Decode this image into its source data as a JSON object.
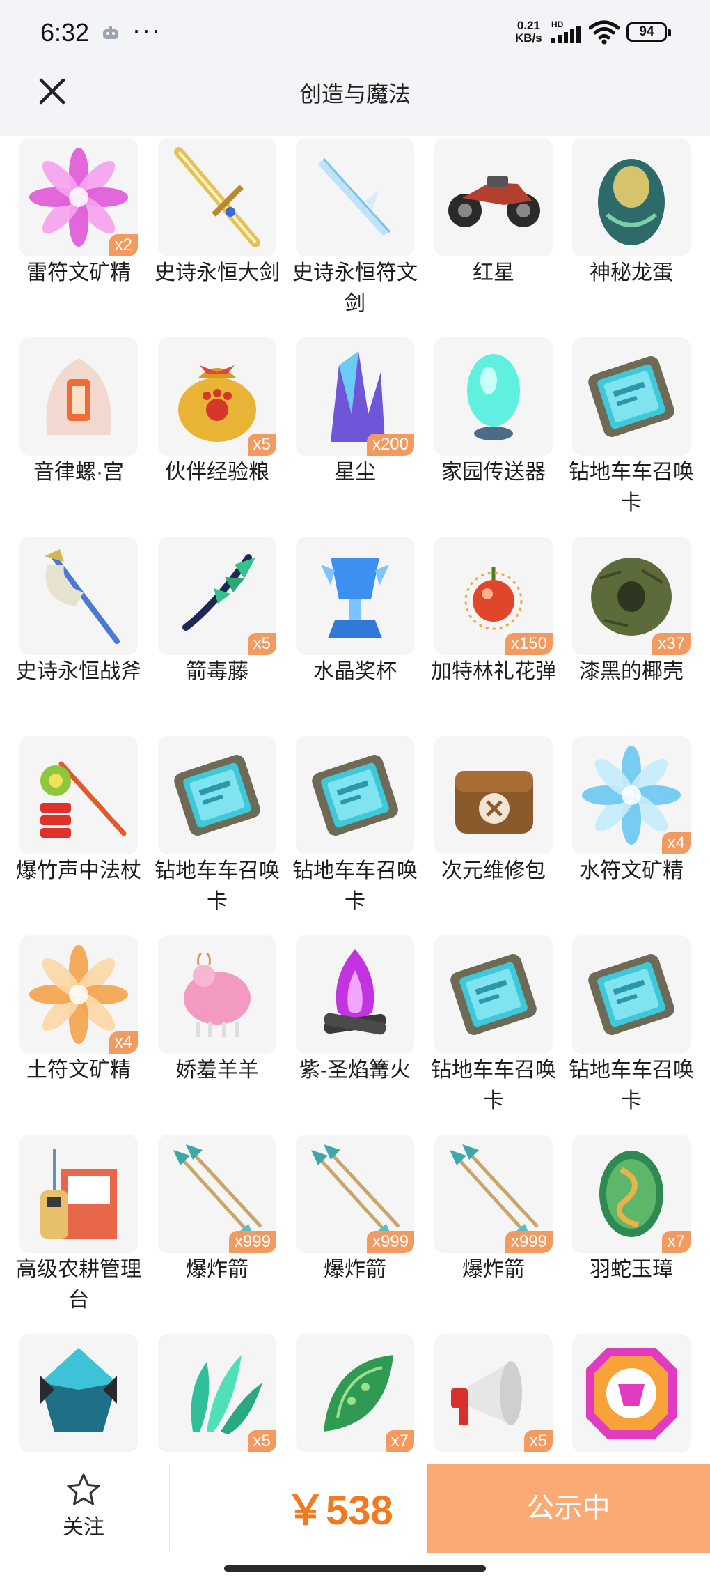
{
  "status_bar": {
    "time": "6:32",
    "more": "···",
    "net_speed_line1": "0.21",
    "net_speed_line2": "KB/s",
    "hd": "HD",
    "battery": "94"
  },
  "header": {
    "title": "创造与魔法"
  },
  "colors": {
    "accent": "#f39a60",
    "price": "#f2791f",
    "status_button": "#fcaa74"
  },
  "items": [
    {
      "name": "雷符文矿精",
      "badge": "x2",
      "icon": "pink-crystal-flower-icon"
    },
    {
      "name": "史诗永恒大剑",
      "badge": "",
      "icon": "golden-greatsword-icon"
    },
    {
      "name": "史诗永恒符文剑",
      "badge": "",
      "icon": "ice-rune-sword-icon"
    },
    {
      "name": "红星",
      "badge": "",
      "icon": "motorcycle-icon"
    },
    {
      "name": "神秘龙蛋",
      "badge": "",
      "icon": "dragon-egg-icon"
    },
    {
      "name": "音律螺·宫",
      "badge": "",
      "icon": "conch-shell-icon"
    },
    {
      "name": "伙伴经验粮",
      "badge": "x5",
      "icon": "paw-food-bag-icon"
    },
    {
      "name": "星尘",
      "badge": "x200",
      "icon": "stardust-crystal-icon"
    },
    {
      "name": "家园传送器",
      "badge": "",
      "icon": "teleporter-egg-icon"
    },
    {
      "name": "钻地车车召唤卡",
      "badge": "",
      "icon": "summon-card-icon"
    },
    {
      "name": "史诗永恒战斧",
      "badge": "",
      "icon": "battle-axe-icon"
    },
    {
      "name": "箭毒藤",
      "badge": "x5",
      "icon": "poison-vine-icon"
    },
    {
      "name": "水晶奖杯",
      "badge": "",
      "icon": "crystal-trophy-icon"
    },
    {
      "name": "加特林礼花弹",
      "badge": "x150",
      "icon": "firework-shell-icon"
    },
    {
      "name": "漆黑的椰壳",
      "badge": "x37",
      "icon": "coconut-shell-icon"
    },
    {
      "name": "爆竹声中法杖",
      "badge": "",
      "icon": "firecracker-staff-icon"
    },
    {
      "name": "钻地车车召唤卡",
      "badge": "",
      "icon": "summon-card-icon"
    },
    {
      "name": "钻地车车召唤卡",
      "badge": "",
      "icon": "summon-card-icon"
    },
    {
      "name": "次元维修包",
      "badge": "",
      "icon": "repair-bag-icon"
    },
    {
      "name": "水符文矿精",
      "badge": "x4",
      "icon": "blue-crystal-flower-icon"
    },
    {
      "name": "土符文矿精",
      "badge": "x4",
      "icon": "orange-crystal-flower-icon"
    },
    {
      "name": "娇羞羊羊",
      "badge": "",
      "icon": "pink-sheep-icon"
    },
    {
      "name": "紫-圣焰篝火",
      "badge": "",
      "icon": "purple-bonfire-icon"
    },
    {
      "name": "钻地车车召唤卡",
      "badge": "",
      "icon": "summon-card-icon"
    },
    {
      "name": "钻地车车召唤卡",
      "badge": "",
      "icon": "summon-card-icon"
    },
    {
      "name": "高级农耕管理台",
      "badge": "",
      "icon": "farm-console-icon"
    },
    {
      "name": "爆炸箭",
      "badge": "x999",
      "icon": "explosive-arrow-icon"
    },
    {
      "name": "爆炸箭",
      "badge": "x999",
      "icon": "explosive-arrow-icon"
    },
    {
      "name": "爆炸箭",
      "badge": "x999",
      "icon": "explosive-arrow-icon"
    },
    {
      "name": "羽蛇玉璋",
      "badge": "x7",
      "icon": "serpent-jade-icon"
    },
    {
      "name": "",
      "badge": "",
      "icon": "teal-gem-icon"
    },
    {
      "name": "",
      "badge": "x5",
      "icon": "teal-leaf-icon"
    },
    {
      "name": "",
      "badge": "x7",
      "icon": "green-scale-icon"
    },
    {
      "name": "",
      "badge": "x5",
      "icon": "megaphone-icon"
    },
    {
      "name": "",
      "badge": "",
      "icon": "rainbow-emblem-icon"
    }
  ],
  "footer": {
    "follow_label": "关注",
    "price": "￥538",
    "status_button": "公示中"
  }
}
